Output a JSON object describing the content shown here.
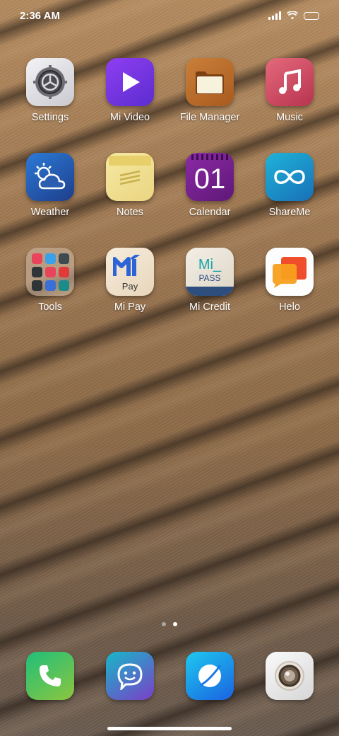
{
  "status_bar": {
    "time": "2:36 AM"
  },
  "apps": [
    {
      "label": "Settings",
      "icon": "settings-icon"
    },
    {
      "label": "Mi Video",
      "icon": "play-icon"
    },
    {
      "label": "File Manager",
      "icon": "folder-icon"
    },
    {
      "label": "Music",
      "icon": "music-note-icon"
    },
    {
      "label": "Weather",
      "icon": "weather-icon"
    },
    {
      "label": "Notes",
      "icon": "notes-icon"
    },
    {
      "label": "Calendar",
      "icon": "calendar-icon",
      "tile_text": "01"
    },
    {
      "label": "ShareMe",
      "icon": "infinity-icon"
    },
    {
      "label": "Tools",
      "icon": "tools-folder-icon"
    },
    {
      "label": "Mi Pay",
      "icon": "mi-pay-icon",
      "tile_text": "Pay"
    },
    {
      "label": "Mi Credit",
      "icon": "mi-credit-icon",
      "tile_text": "Mi_",
      "tile_subtext": "PASS"
    },
    {
      "label": "Helo",
      "icon": "helo-icon"
    }
  ],
  "dock": [
    {
      "icon": "phone-icon"
    },
    {
      "icon": "messages-icon"
    },
    {
      "icon": "browser-icon"
    },
    {
      "icon": "camera-icon"
    }
  ],
  "page_indicator": {
    "count": 2,
    "active": 2
  }
}
